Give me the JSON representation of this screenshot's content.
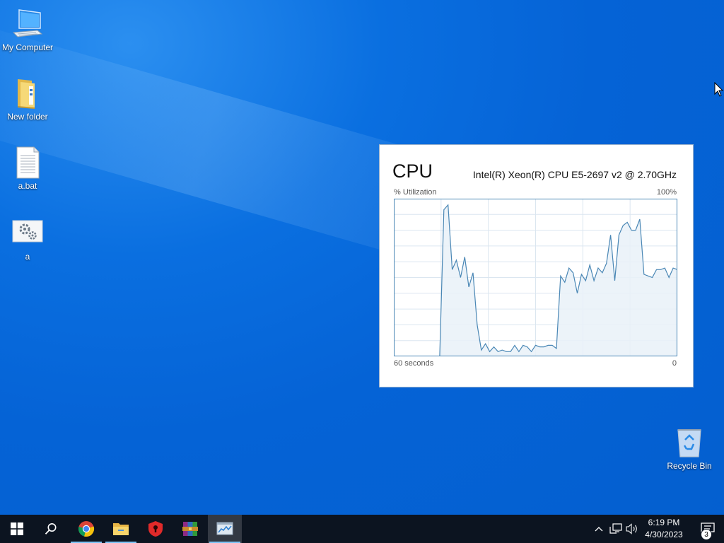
{
  "desktop": {
    "icons": [
      {
        "label": "My Computer",
        "icon": "computer-icon"
      },
      {
        "label": "New folder",
        "icon": "folder-icon"
      },
      {
        "label": "a.bat",
        "icon": "batch-file-icon"
      },
      {
        "label": "a",
        "icon": "settings-file-icon"
      },
      {
        "label": "Recycle Bin",
        "icon": "recycle-bin-icon"
      }
    ]
  },
  "cpu_widget": {
    "title": "CPU",
    "model": "Intel(R) Xeon(R) CPU E5-2697 v2 @ 2.70GHz",
    "utilization_label": "% Utilization",
    "utilization_max": "100%",
    "time_label": "60 seconds",
    "time_min": "0",
    "line_color": "#4a87b5",
    "fill_color": "#e9f1f8",
    "chart_data": {
      "type": "area",
      "x": [
        60,
        59,
        58,
        57,
        56,
        55,
        54,
        53,
        52,
        51,
        50,
        49,
        48,
        47,
        46,
        45,
        44,
        43,
        42,
        41,
        40,
        39,
        38,
        37,
        36,
        35,
        34,
        33,
        32,
        31,
        30,
        29,
        28,
        27,
        26,
        25,
        24,
        23,
        22,
        21,
        20,
        19,
        18,
        17,
        16,
        15,
        14,
        13,
        12,
        11,
        10,
        9,
        8,
        7,
        6,
        5,
        4,
        3,
        2,
        1,
        0
      ],
      "values": [
        0,
        0,
        0,
        0,
        0,
        0,
        0,
        0,
        0,
        0,
        0,
        0,
        93,
        96,
        55,
        61,
        50,
        63,
        44,
        53,
        20,
        4,
        8,
        3,
        6,
        3,
        4,
        3,
        3,
        7,
        3,
        7,
        6,
        3,
        7,
        6,
        6,
        7,
        7,
        5,
        51,
        47,
        56,
        53,
        40,
        52,
        48,
        58,
        48,
        56,
        53,
        59,
        77,
        48,
        77,
        83,
        85,
        80,
        80,
        87,
        52,
        51,
        50,
        55,
        55,
        56,
        50,
        56,
        55
      ]
    }
  },
  "taskbar": {
    "items": [
      {
        "name": "start-button",
        "icon": "windows-logo-icon"
      },
      {
        "name": "search-button",
        "icon": "search-icon"
      },
      {
        "name": "chrome-button",
        "icon": "chrome-icon"
      },
      {
        "name": "file-explorer-button",
        "icon": "folder-icon"
      },
      {
        "name": "security-app-button",
        "icon": "shield-icon"
      },
      {
        "name": "winrar-button",
        "icon": "archive-icon"
      },
      {
        "name": "task-manager-button",
        "icon": "task-manager-icon"
      }
    ],
    "clock": {
      "time": "6:19 PM",
      "date": "4/30/2023"
    },
    "notification_count": "3"
  }
}
